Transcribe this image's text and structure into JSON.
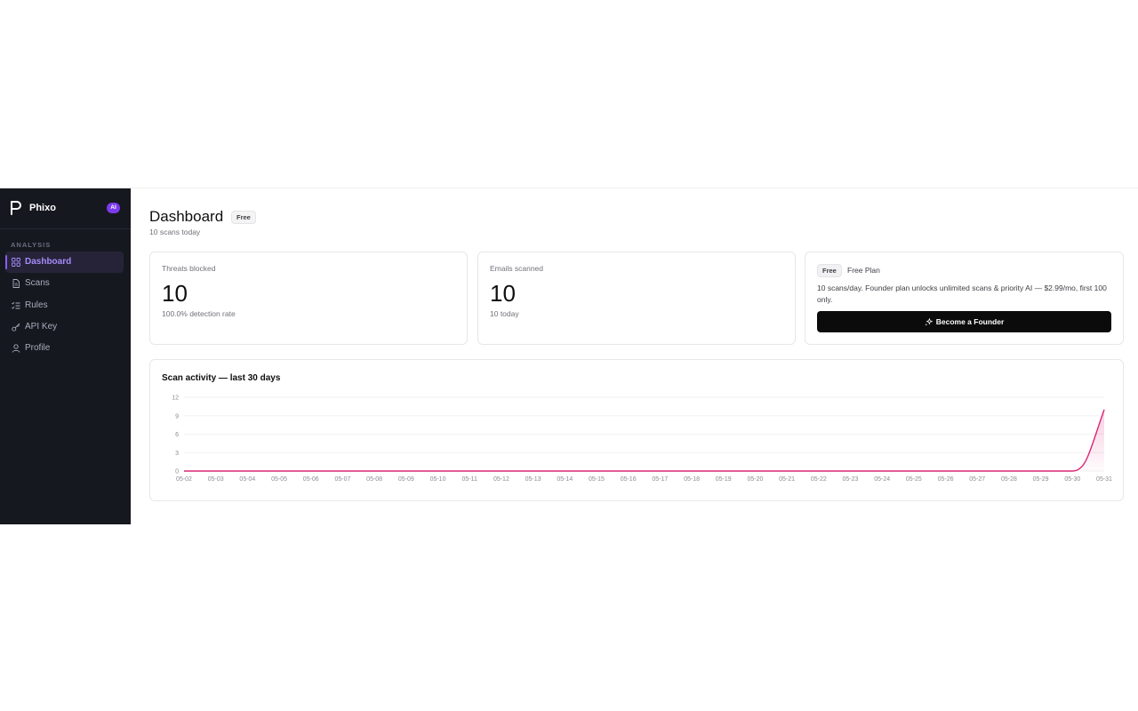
{
  "sidebar": {
    "brand_name": "Phixo",
    "ai_badge": "AI",
    "section_label": "ANALYSIS",
    "items": [
      {
        "label": "Dashboard",
        "icon": "grid-icon",
        "active": true
      },
      {
        "label": "Scans",
        "icon": "document-icon",
        "active": false
      },
      {
        "label": "Rules",
        "icon": "list-check-icon",
        "active": false
      },
      {
        "label": "API Key",
        "icon": "key-icon",
        "active": false
      },
      {
        "label": "Profile",
        "icon": "user-icon",
        "active": false
      }
    ]
  },
  "header": {
    "title": "Dashboard",
    "plan_tag": "Free",
    "subtitle": "10 scans today"
  },
  "stats": [
    {
      "label": "Threats blocked",
      "value": "10",
      "sub": "100.0% detection rate"
    },
    {
      "label": "Emails scanned",
      "value": "10",
      "sub": "10 today"
    }
  ],
  "plan_card": {
    "badge": "Free",
    "name": "Free Plan",
    "description": "10 scans/day. Founder plan unlocks unlimited scans & priority AI — $2.99/mo, first 100 only.",
    "button_label": "Become a Founder",
    "button_icon": "sparkles-icon"
  },
  "colors": {
    "sidebar_bg": "#16181f",
    "accent": "#8b5cf6",
    "line": "#db2777"
  },
  "chart_data": {
    "type": "area",
    "title": "Scan activity — last 30 days",
    "x": [
      "05-02",
      "05-03",
      "05-04",
      "05-05",
      "05-06",
      "05-07",
      "05-08",
      "05-09",
      "05-10",
      "05-11",
      "05-12",
      "05-13",
      "05-14",
      "05-15",
      "05-16",
      "05-17",
      "05-18",
      "05-19",
      "05-20",
      "05-21",
      "05-22",
      "05-23",
      "05-24",
      "05-25",
      "05-26",
      "05-27",
      "05-28",
      "05-29",
      "05-30",
      "05-31"
    ],
    "values": [
      0,
      0,
      0,
      0,
      0,
      0,
      0,
      0,
      0,
      0,
      0,
      0,
      0,
      0,
      0,
      0,
      0,
      0,
      0,
      0,
      0,
      0,
      0,
      0,
      0,
      0,
      0,
      0,
      0,
      10
    ],
    "yticks": [
      0,
      3,
      6,
      9,
      12
    ],
    "ylim": [
      0,
      12
    ],
    "grid": true,
    "legend": "none"
  }
}
